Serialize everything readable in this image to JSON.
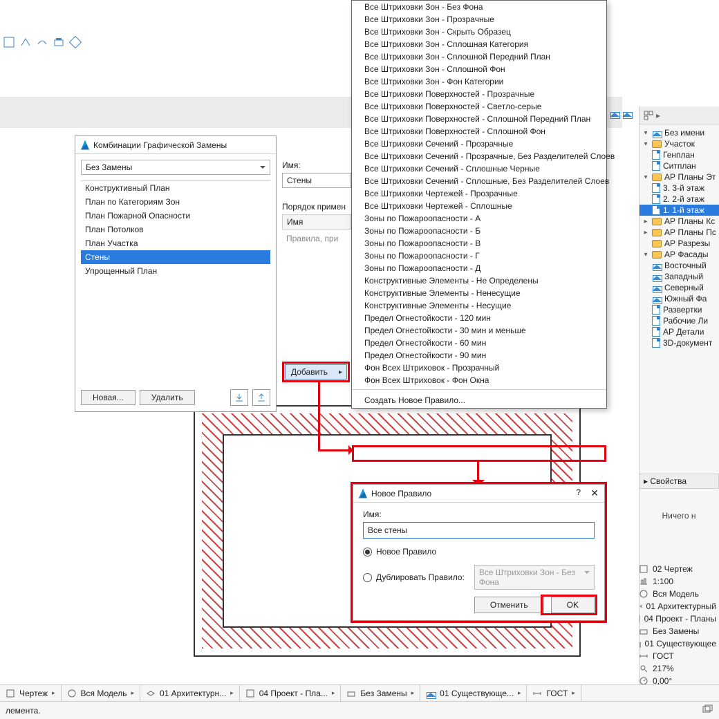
{
  "dialog_comb": {
    "title": "Комбинации Графической Замены",
    "combo_value": "Без Замены",
    "items": [
      "Конструктивный План",
      "План по Категориям Зон",
      "План Пожарной Опасности",
      "План Потолков",
      "План Участка",
      "Стены",
      "Упрощенный План"
    ],
    "selected_index": 5,
    "btn_new": "Новая...",
    "btn_delete": "Удалить"
  },
  "midcol": {
    "name_label": "Имя:",
    "name_value": "Стены",
    "order_label": "Порядок примен",
    "col_header": "Имя",
    "placeholder": "Правила, при"
  },
  "btn_add": "Добавить",
  "dropdown": {
    "items": [
      "Все Штриховки Зон - Без Фона",
      "Все Штриховки Зон - Прозрачные",
      "Все Штриховки Зон - Скрыть Образец",
      "Все Штриховки Зон - Сплошная Категория",
      "Все Штриховки Зон - Сплошной Передний План",
      "Все Штриховки Зон - Сплошной Фон",
      "Все Штриховки Зон - Фон Категории",
      "Все Штриховки Поверхностей - Прозрачные",
      "Все Штриховки Поверхностей - Светло-серые",
      "Все Штриховки Поверхностей - Сплошной Передний План",
      "Все Штриховки Поверхностей - Сплошной Фон",
      "Все Штриховки Сечений - Прозрачные",
      "Все Штриховки Сечений - Прозрачные, Без Разделителей Слоев",
      "Все Штриховки Сечений - Сплошные Черные",
      "Все Штриховки Сечений - Сплошные, Без Разделителей Слоев",
      "Все Штриховки Чертежей - Прозрачные",
      "Все Штриховки Чертежей - Сплошные",
      "Зоны по Пожароопасности - А",
      "Зоны по Пожароопасности - Б",
      "Зоны по Пожароопасности - В",
      "Зоны по Пожароопасности - Г",
      "Зоны по Пожароопасности - Д",
      "Конструктивные Элементы - Не Определены",
      "Конструктивные Элементы - Ненесущие",
      "Конструктивные Элементы - Несущие",
      "Предел Огнестойкости - 120 мин",
      "Предел Огнестойкости - 30 мин и меньше",
      "Предел Огнестойкости - 60 мин",
      "Предел Огнестойкости - 90 мин",
      "Фон Всех Штриховок - Прозрачный",
      "Фон Всех Штриховок - Фон Окна"
    ],
    "create": "Создать Новое Правило..."
  },
  "dialog_new": {
    "title": "Новое Правило",
    "name_label": "Имя:",
    "name_value": "Все стены",
    "radio_new": "Новое Правило",
    "radio_dup": "Дублировать Правило:",
    "dup_value": "Все Штриховки Зон - Без Фона",
    "btn_cancel": "Отменить",
    "btn_ok": "OK"
  },
  "nav": {
    "root": "Без имени",
    "items": [
      {
        "t": "Участок",
        "ind": 1,
        "caret": "v",
        "ic": "folder"
      },
      {
        "t": "Генплан",
        "ind": 2,
        "ic": "doc"
      },
      {
        "t": "Ситплан",
        "ind": 2,
        "ic": "doc"
      },
      {
        "t": "АР Планы Эт",
        "ind": 1,
        "caret": "v",
        "ic": "folder"
      },
      {
        "t": "3. 3-й этаж",
        "ind": 2,
        "ic": "doc"
      },
      {
        "t": "2. 2-й этаж",
        "ind": 2,
        "ic": "doc"
      },
      {
        "t": "1. 1-й этаж",
        "ind": 2,
        "ic": "doc",
        "sel": true
      },
      {
        "t": "АР Планы Кс",
        "ind": 1,
        "caret": ">",
        "ic": "folder"
      },
      {
        "t": "АР Планы Пс",
        "ind": 1,
        "caret": ">",
        "ic": "folder"
      },
      {
        "t": "АР Разрезы",
        "ind": 1,
        "ic": "folder"
      },
      {
        "t": "АР Фасады",
        "ind": 1,
        "caret": "v",
        "ic": "folder"
      },
      {
        "t": "Восточный",
        "ind": 2,
        "ic": "house"
      },
      {
        "t": "Западный",
        "ind": 2,
        "ic": "house"
      },
      {
        "t": "Северный",
        "ind": 2,
        "ic": "house"
      },
      {
        "t": "Южный Фа",
        "ind": 2,
        "ic": "house"
      },
      {
        "t": "Развертки",
        "ind": 0,
        "ic": "doc"
      },
      {
        "t": "Рабочие Ли",
        "ind": 0,
        "ic": "doc"
      },
      {
        "t": "АР Детали",
        "ind": 0,
        "ic": "doc"
      },
      {
        "t": "3D-документ",
        "ind": 0,
        "ic": "doc"
      }
    ]
  },
  "props": {
    "header": "Свойства",
    "empty": "Ничего н"
  },
  "status": [
    "02 Чертеж",
    "1:100",
    "Вся Модель",
    "01 Архитектурный",
    "04 Проект - Планы",
    "Без Замены",
    "01 Существующее",
    "ГОСТ",
    "217%",
    "0,00°"
  ],
  "bottombar": {
    "seg1": "Чертеж",
    "seg2": "Вся Модель",
    "seg3": "01 Архитектурн...",
    "seg4": "04 Проект - Пла...",
    "seg5": "Без Замены",
    "seg6": "01 Существующе...",
    "seg7": "ГОСТ"
  },
  "footer": {
    "left": "лемента."
  }
}
